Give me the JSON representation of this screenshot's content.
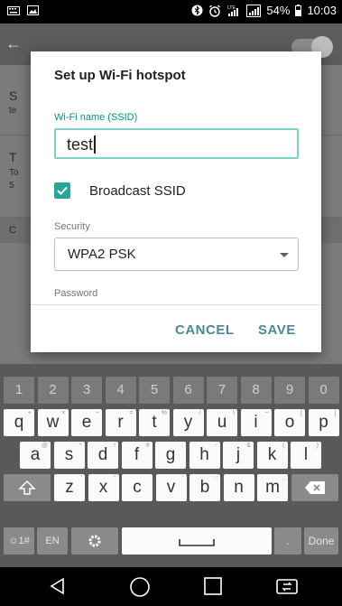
{
  "status_bar": {
    "battery_percent": "54%",
    "time": "10:03"
  },
  "dialog": {
    "title": "Set up Wi-Fi hotspot",
    "ssid_label": "Wi-Fi name (SSID)",
    "ssid_value": "test",
    "broadcast_label": "Broadcast SSID",
    "broadcast_checked": true,
    "security_label": "Security",
    "security_value": "WPA2 PSK",
    "password_label": "Password",
    "cancel_label": "CANCEL",
    "save_label": "SAVE"
  },
  "keyboard": {
    "row_numbers": [
      "1",
      "2",
      "3",
      "4",
      "5",
      "6",
      "7",
      "8",
      "9",
      "0"
    ],
    "row1": [
      "q",
      "w",
      "e",
      "r",
      "t",
      "y",
      "u",
      "i",
      "o",
      "p"
    ],
    "row1_hints": [
      "+",
      "×",
      "÷",
      "=",
      "%",
      "/",
      "\\",
      "~",
      "[",
      "]"
    ],
    "row2": [
      "a",
      "s",
      "d",
      "f",
      "g",
      "h",
      "j",
      "k",
      "l"
    ],
    "row2_hints": [
      "@",
      "*",
      "!",
      "#",
      ":",
      "-",
      "&",
      "(",
      ")"
    ],
    "row3": [
      "z",
      "x",
      "c",
      "v",
      "b",
      "n",
      "m"
    ],
    "row3_hints": [
      "'",
      "\"",
      "`",
      "'",
      ";",
      "",
      ",",
      "?"
    ],
    "symbols_label": "☺1#",
    "lang_label": "EN",
    "period_label": ".",
    "done_label": "Done"
  },
  "colors": {
    "accent": "#26a69a",
    "button_text": "#4a8a96"
  }
}
